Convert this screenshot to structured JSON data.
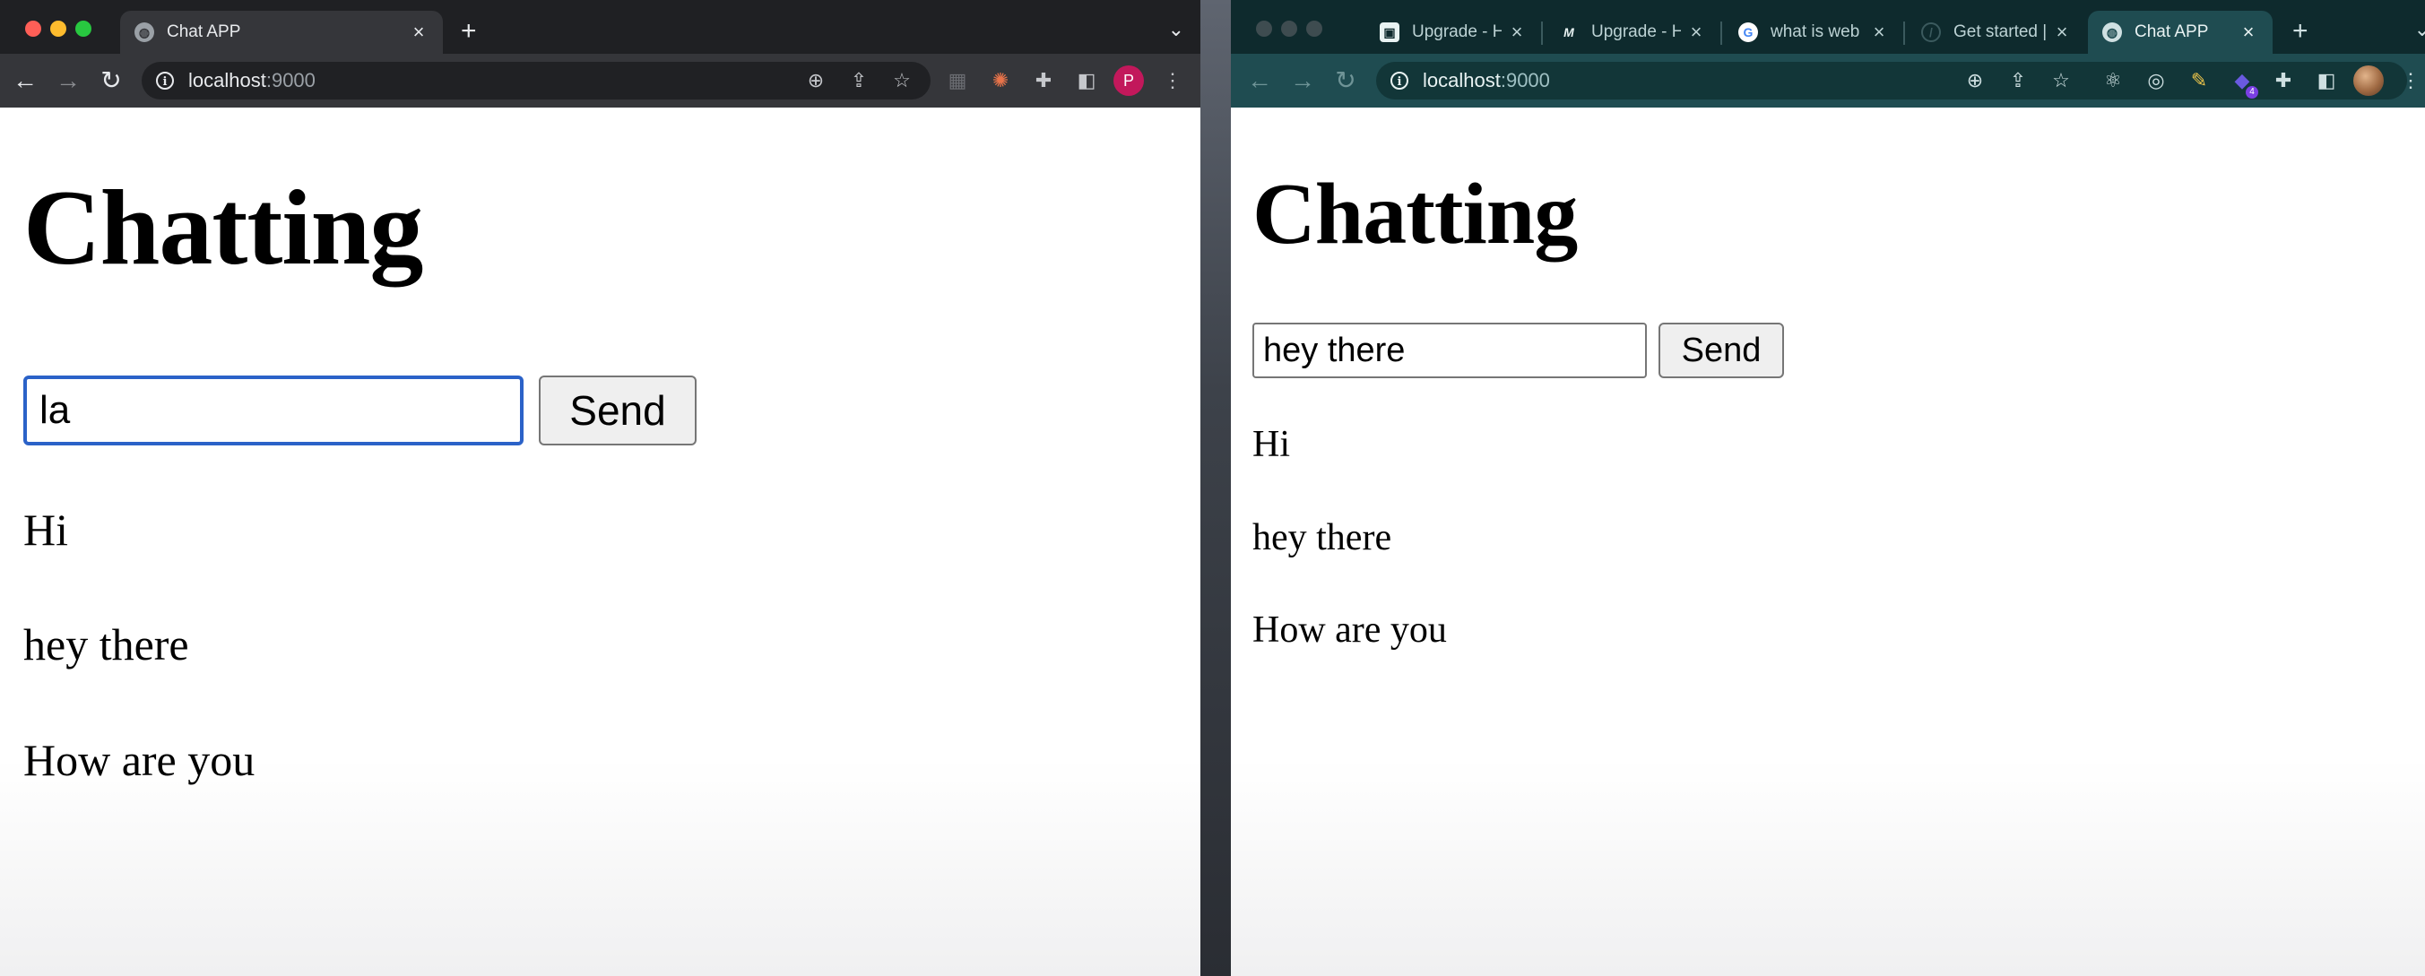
{
  "left_window": {
    "tab": {
      "title": "Chat APP"
    },
    "address": {
      "host": "localhost",
      "port": ":9000"
    },
    "profile_initial": "P",
    "page": {
      "heading": "Chatting",
      "input_value": "la",
      "send_label": "Send",
      "messages": [
        "Hi",
        "hey there",
        "How are you"
      ]
    }
  },
  "right_window": {
    "tabs": [
      {
        "title": "Upgrade - H",
        "icon": "upgrade-favicon"
      },
      {
        "title": "Upgrade - H",
        "icon": "medium-favicon"
      },
      {
        "title": "what is web",
        "icon": "google-favicon"
      },
      {
        "title": "Get started |",
        "icon": "generic-favicon"
      },
      {
        "title": "Chat APP",
        "icon": "globe-favicon"
      }
    ],
    "address": {
      "host": "localhost",
      "port": ":9000"
    },
    "extension_badge": "4",
    "page": {
      "heading": "Chatting",
      "input_value": "hey there",
      "send_label": "Send",
      "messages": [
        "Hi",
        "hey there",
        "How are you"
      ]
    }
  },
  "colors": {
    "left_chrome": "#35363a",
    "right_chrome": "#1f4c51",
    "focus_ring": "#2b62c8",
    "profile_avatar": "#c2185b"
  }
}
